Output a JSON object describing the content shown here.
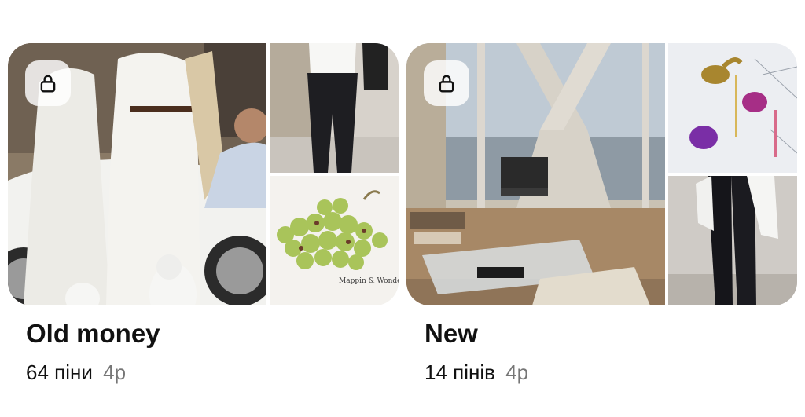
{
  "boards": [
    {
      "title": "Old money",
      "pin_count": "64 піни",
      "age": "4р",
      "private": true,
      "lock_icon": "lock-icon",
      "thumbnail_caption": "Mappin & Wonderful"
    },
    {
      "title": "New",
      "pin_count": "14 пінів",
      "age": "4р",
      "private": true,
      "lock_icon": "lock-icon"
    }
  ],
  "colors": {
    "title": "#111111",
    "meta_secondary": "#767676",
    "lock_badge_bg": "#ffffffd1"
  }
}
